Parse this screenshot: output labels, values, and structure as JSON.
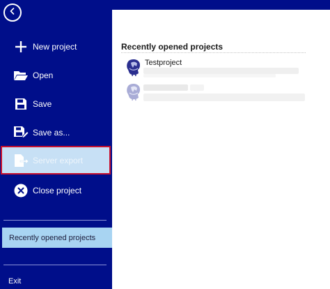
{
  "sidebar": {
    "back_icon": "chevron-left-icon",
    "items": [
      {
        "label": "New project",
        "icon": "plus-icon"
      },
      {
        "label": "Open",
        "icon": "folder-open-icon"
      },
      {
        "label": "Save",
        "icon": "floppy-disk-icon"
      },
      {
        "label": "Save  as...",
        "icon": "floppy-disk-pencil-icon"
      },
      {
        "label": "Server export",
        "icon": "server-export-icon",
        "state": "highlighted"
      },
      {
        "label": "Close project",
        "icon": "close-circle-icon"
      }
    ],
    "recent_label": "Recently opened projects",
    "exit_label": "Exit"
  },
  "main": {
    "section_title": "Recently opened projects",
    "projects": [
      {
        "name": "Testproject"
      },
      {
        "name": ""
      }
    ]
  },
  "colors": {
    "sidebar_bg": "#000e8a",
    "selected_nav_bg": "#a8d4f2",
    "highlight_border": "#c8102e",
    "highlight_bg": "#c7e0f5"
  }
}
